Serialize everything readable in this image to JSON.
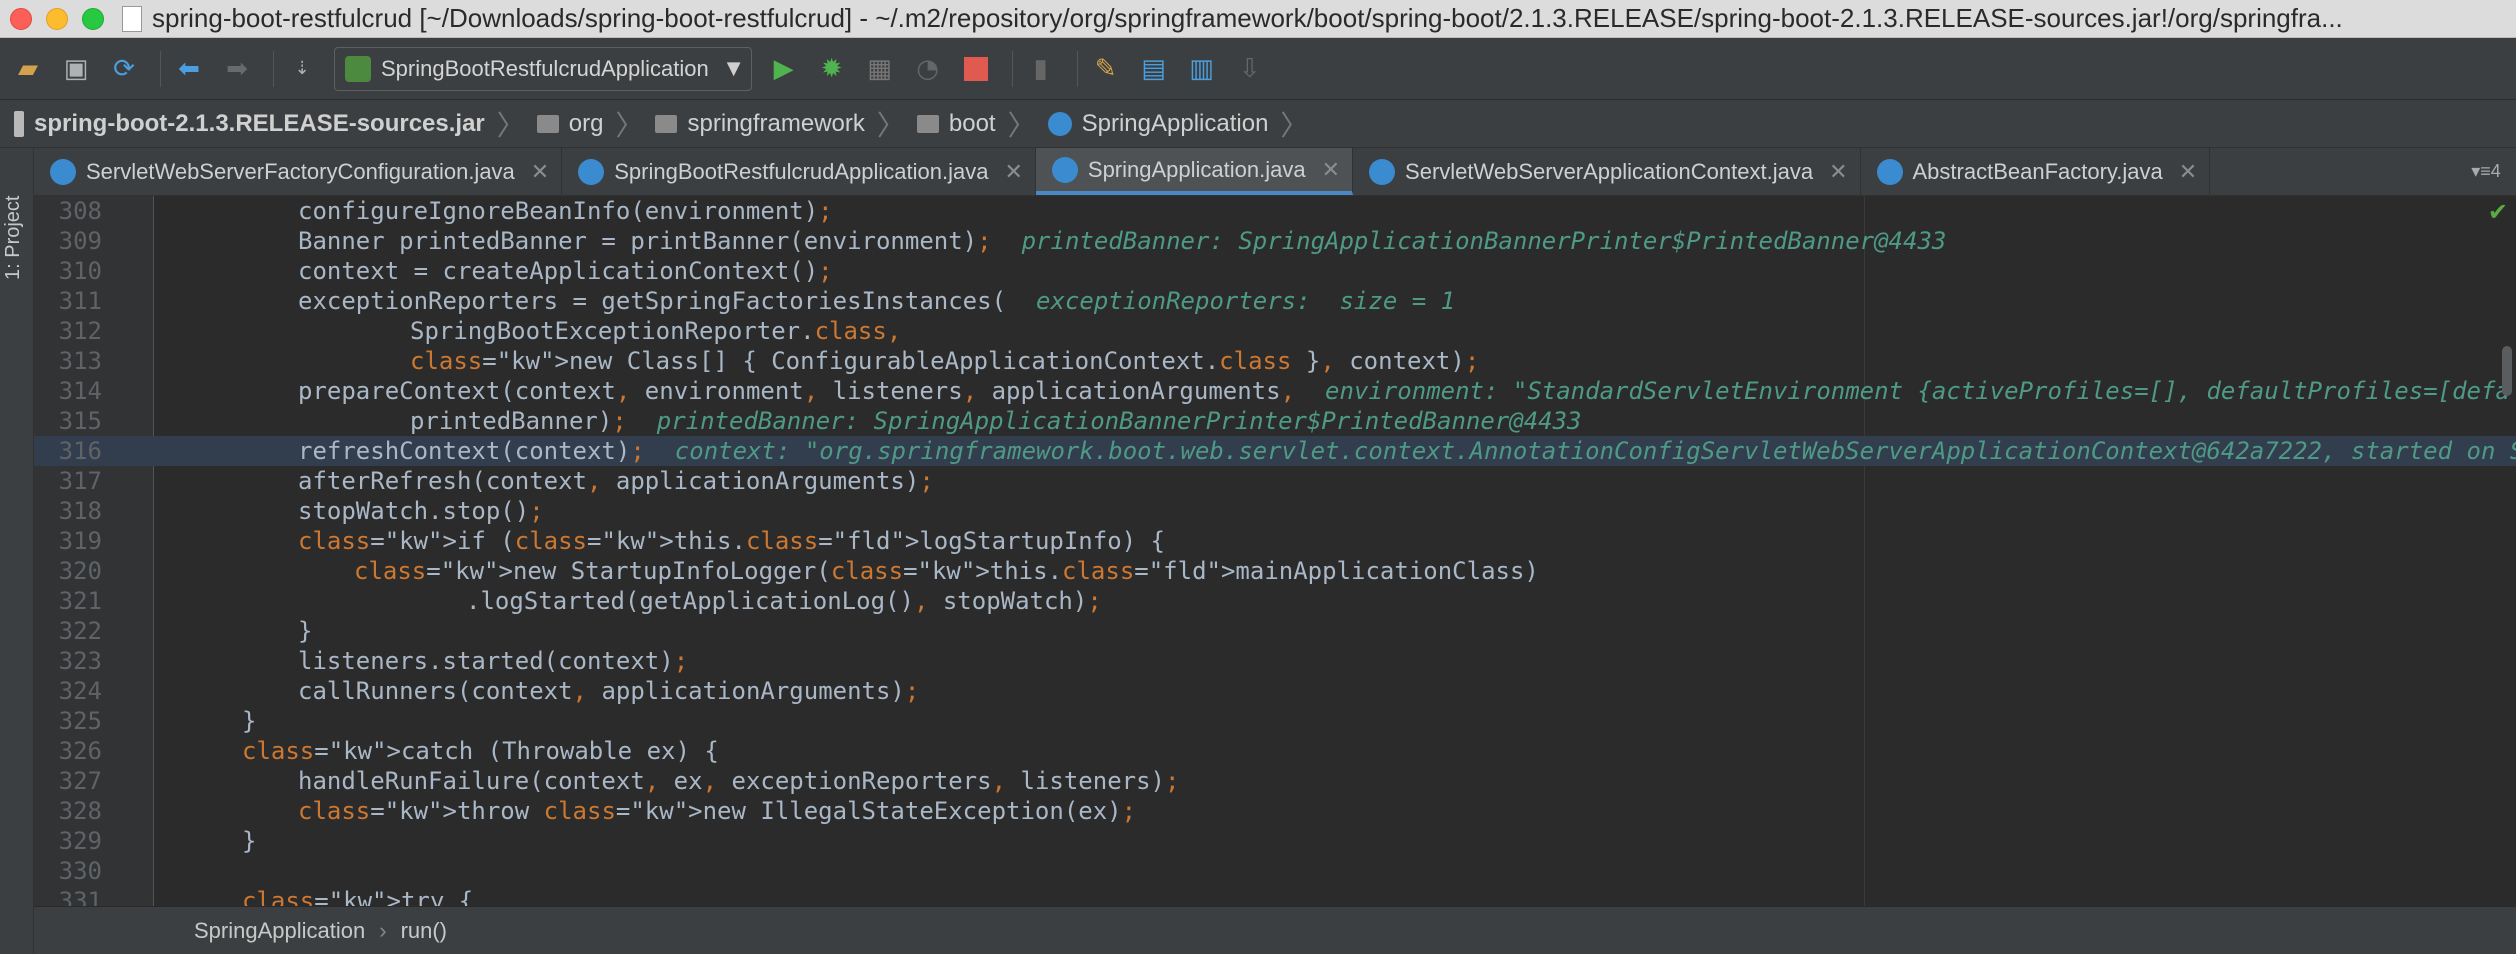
{
  "window": {
    "title": "spring-boot-restfulcrud [~/Downloads/spring-boot-restfulcrud] - ~/.m2/repository/org/springframework/boot/spring-boot/2.1.3.RELEASE/spring-boot-2.1.3.RELEASE-sources.jar!/org/springfra..."
  },
  "toolbar": {
    "run_config_label": "SpringBootRestfulcrudApplication"
  },
  "breadcrumb": [
    {
      "label": "spring-boot-2.1.3.RELEASE-sources.jar",
      "icon": "jar-icon"
    },
    {
      "label": "org",
      "icon": "folder-icon"
    },
    {
      "label": "springframework",
      "icon": "folder-icon"
    },
    {
      "label": "boot",
      "icon": "folder-icon"
    },
    {
      "label": "SpringApplication",
      "icon": "class-icon"
    }
  ],
  "left_panel": {
    "project_label": "1: Project"
  },
  "tabs": [
    {
      "label": "ServletWebServerFactoryConfiguration.java",
      "active": false
    },
    {
      "label": "SpringBootRestfulcrudApplication.java",
      "active": false
    },
    {
      "label": "SpringApplication.java",
      "active": true
    },
    {
      "label": "ServletWebServerApplicationContext.java",
      "active": false
    },
    {
      "label": "AbstractBeanFactory.java",
      "active": false
    }
  ],
  "tabs_menu": "4",
  "editor": {
    "lines": [
      {
        "num": "308",
        "code": "\t\t\tconfigureIgnoreBeanInfo(environment);"
      },
      {
        "num": "309",
        "code": "\t\t\tBanner printedBanner = printBanner(environment);",
        "hint": "printedBanner: SpringApplicationBannerPrinter$PrintedBanner@4433"
      },
      {
        "num": "310",
        "code": "\t\t\tcontext = createApplicationContext();"
      },
      {
        "num": "311",
        "code": "\t\t\texceptionReporters = getSpringFactoriesInstances(",
        "hint": "exceptionReporters:  size = 1"
      },
      {
        "num": "312",
        "code": "\t\t\t\t\tSpringBootExceptionReporter.class,"
      },
      {
        "num": "313",
        "code": "\t\t\t\t\tnew Class[] { ConfigurableApplicationContext.class }, context);"
      },
      {
        "num": "314",
        "code": "\t\t\tprepareContext(context, environment, listeners, applicationArguments,",
        "hint": "environment: \"StandardServletEnvironment {activeProfiles=[], defaultProfiles=[defa"
      },
      {
        "num": "315",
        "code": "\t\t\t\t\tprintedBanner);",
        "hint": "printedBanner: SpringApplicationBannerPrinter$PrintedBanner@4433"
      },
      {
        "num": "316",
        "code": "\t\t\trefreshContext(context);",
        "hint": "context: \"org.springframework.boot.web.servlet.context.AnnotationConfigServletWebServerApplicationContext@642a7222, started on S",
        "highlight": true
      },
      {
        "num": "317",
        "code": "\t\t\tafterRefresh(context, applicationArguments);"
      },
      {
        "num": "318",
        "code": "\t\t\tstopWatch.stop();"
      },
      {
        "num": "319",
        "code": "\t\t\tif (this.logStartupInfo) {"
      },
      {
        "num": "320",
        "code": "\t\t\t\tnew StartupInfoLogger(this.mainApplicationClass)"
      },
      {
        "num": "321",
        "code": "\t\t\t\t\t\t.logStarted(getApplicationLog(), stopWatch);"
      },
      {
        "num": "322",
        "code": "\t\t\t}"
      },
      {
        "num": "323",
        "code": "\t\t\tlisteners.started(context);"
      },
      {
        "num": "324",
        "code": "\t\t\tcallRunners(context, applicationArguments);"
      },
      {
        "num": "325",
        "code": "\t\t}"
      },
      {
        "num": "326",
        "code": "\t\tcatch (Throwable ex) {"
      },
      {
        "num": "327",
        "code": "\t\t\thandleRunFailure(context, ex, exceptionReporters, listeners);"
      },
      {
        "num": "328",
        "code": "\t\t\tthrow new IllegalStateException(ex);"
      },
      {
        "num": "329",
        "code": "\t\t}"
      },
      {
        "num": "330",
        "code": ""
      },
      {
        "num": "331",
        "code": "\t\ttry {"
      }
    ]
  },
  "bottom_breadcrumb": {
    "class": "SpringApplication",
    "method": "run()"
  },
  "colors": {
    "keyword": "#cc7832",
    "field": "#9876aa",
    "inline_hint": "#4e9a86",
    "text": "#a9b7c6"
  }
}
